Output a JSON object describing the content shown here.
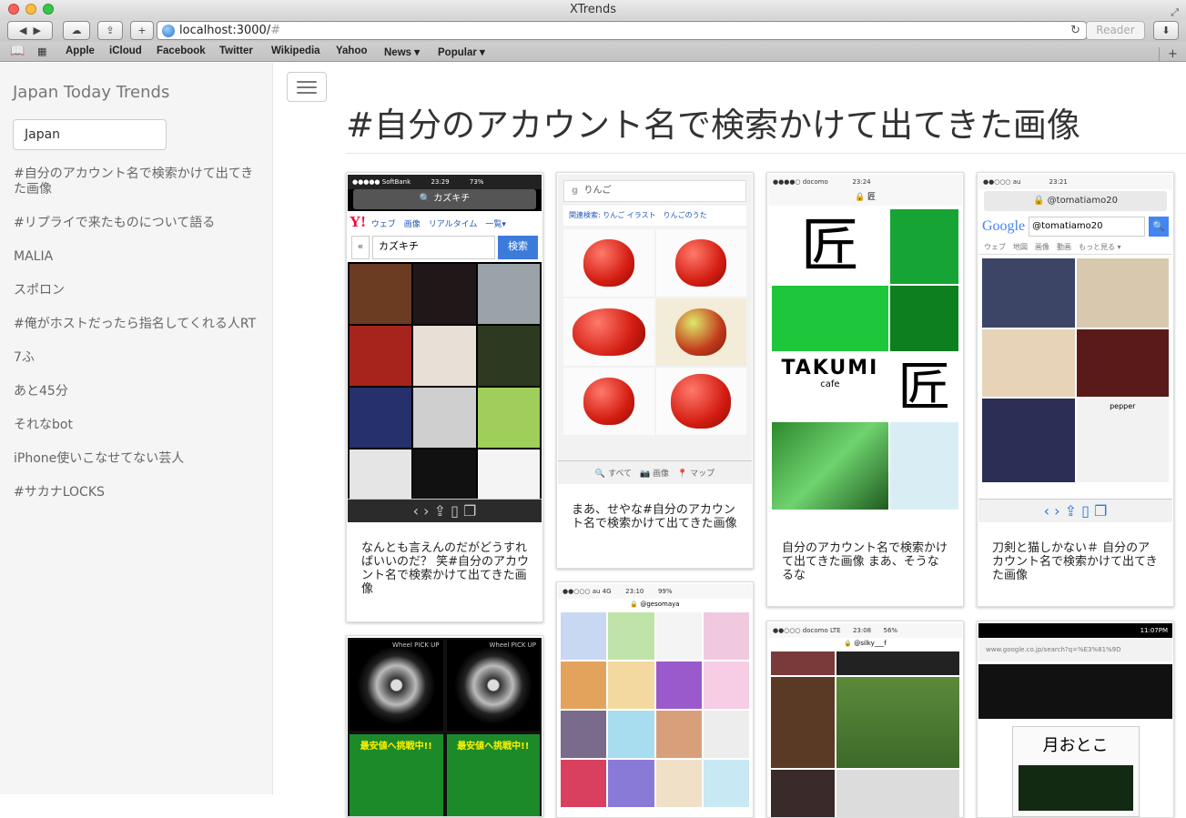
{
  "window": {
    "title": "XTrends"
  },
  "toolbar": {
    "url_host": "localhost:3000/",
    "url_hash": "#",
    "reader_label": "Reader"
  },
  "bookmarks": [
    "Apple",
    "iCloud",
    "Facebook",
    "Twitter",
    "Wikipedia",
    "Yahoo",
    "News ▾",
    "Popular ▾"
  ],
  "sidebar": {
    "brand": "Japan Today Trends",
    "country_value": "Japan",
    "items": [
      "#自分のアカウント名で検索かけて出てきた画像",
      "#リプライで来たものについて語る",
      "MALIA",
      "スポロン",
      "#俺がホストだったら指名してくれる人RT",
      "7ふ",
      "あと45分",
      "それなbot",
      "iPhone使いこなせてない芸人",
      "#サカナLOCKS"
    ]
  },
  "main": {
    "title": "#自分のアカウント名で検索かけて出てきた画像",
    "cards": [
      {
        "caption": "なんとも言えんのだがどうすればいいのだ？ 笑#自分のアカウント名で検索かけて出てきた画像",
        "status_left": "●●●●● SoftBank",
        "status_time": "23:29",
        "status_right": "73%",
        "url_text": "🔍 カズキチ",
        "search_tabs": "ウェブ　画像　リアルタイム　一覧▾",
        "search_query": "カズキチ",
        "search_button": "検索"
      },
      {
        "caption": "まあ、せやな#自分のアカウント名で検索かけて出てきた画像",
        "search_query": "りんご",
        "related": "関連検索: りんご イラスト　りんごのうた",
        "bottom_tabs": "🔍 すべて　📷 画像　📍 マップ"
      },
      {
        "caption": "自分のアカウント名で検索かけて出てきた画像 まあ、そうなるな",
        "status_left": "●●●●○ docomo",
        "status_time": "23:24",
        "url_text": "🔒 匠",
        "kanji": "匠",
        "takumi": "TAKUMI",
        "cafe": "cafe"
      },
      {
        "caption": "刀剣と猫しかない＃ 自分のアカウント名で検索かけて出てきた画像",
        "status_left": "●●○○○ au",
        "status_time": "23:21",
        "url_text": "🔒 @tomatiamo20",
        "google_logo": "Google",
        "search_query": "@tomatiamo20",
        "google_tabs": "ウェブ　地図　画像　動画　もっと見る ▾",
        "pepper": "pepper"
      },
      {
        "wheel_label": "Wheel PICK UP",
        "banner": "最安値へ挑戦中!!"
      },
      {
        "status_left": "●●○○○ au 4G",
        "status_time": "23:10",
        "status_right": "99%",
        "url_text": "🔒 @gesomaya"
      },
      {
        "status_left": "●●○○○ docomo LTE",
        "status_time": "23:08",
        "status_right": "56%",
        "url_text": "🔒 @silky___f"
      },
      {
        "status_time": "11:07PM",
        "url_text": "www.google.co.jp/search?q=%E3%81%9D",
        "book_title": "月おとこ"
      }
    ]
  },
  "colors": {
    "sidebar_bg": "#f5f5f5",
    "link_blue": "#1f7ae0",
    "yahoo_red": "#ff0033",
    "minecraft_green": "#16a534"
  }
}
